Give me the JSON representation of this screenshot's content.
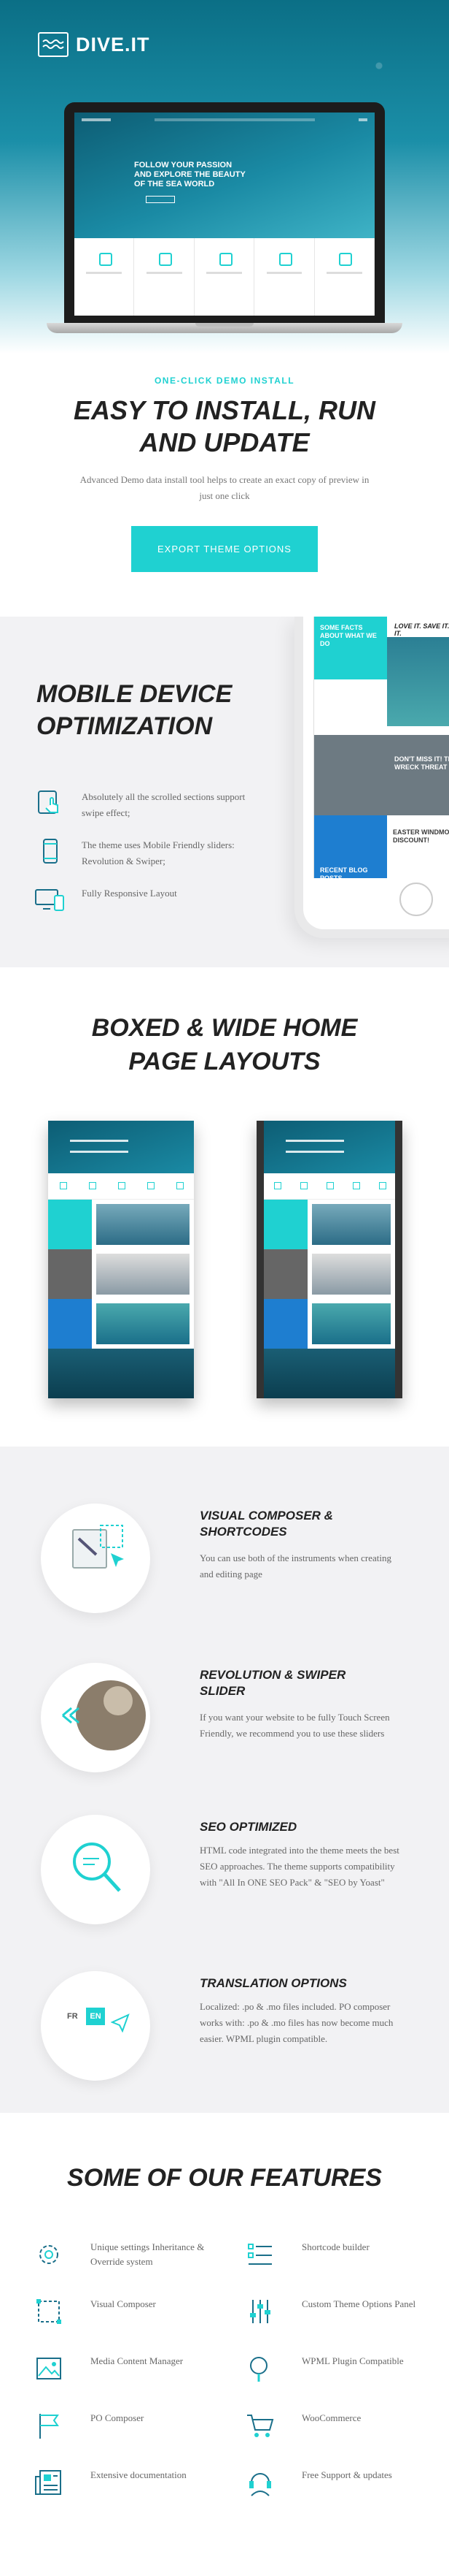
{
  "hero": {
    "logo": "DIVE.IT",
    "laptop_headline_line1": "FOLLOW YOUR PASSION",
    "laptop_headline_line2": "AND EXPLORE THE BEAUTY",
    "laptop_headline_line3": "OF THE SEA WORLD"
  },
  "install": {
    "eyebrow": "ONE-CLICK DEMO INSTALL",
    "title_line1": "EASY TO INSTALL, RUN",
    "title_line2": "AND UPDATE",
    "description": "Advanced Demo data install tool helps to create an exact copy of preview in just one click",
    "button": "EXPORT THEME OPTIONS"
  },
  "mobile": {
    "title_line1": "MOBILE DEVICE",
    "title_line2": "OPTIMIZATION",
    "features": [
      {
        "text": "Absolutely all the scrolled sections support swipe effect;",
        "icon": "touch-tablet-icon"
      },
      {
        "text": "The theme uses Mobile Friendly sliders: Revolution & Swiper;",
        "icon": "smartphone-icon"
      },
      {
        "text": "Fully Responsive Layout",
        "icon": "devices-icon"
      }
    ],
    "phone": {
      "header": "LOVE IT. SAVE IT. DIVE IT.",
      "blocks": [
        "SOME FACTS ABOUT WHAT WE DO",
        "DON'T MISS IT! TRIPLE WRECK THREAT",
        "EASTER WINDMOUNT DISCOUNT!",
        "RECENT BLOG POSTS"
      ]
    }
  },
  "boxed": {
    "title_line1": "BOXED & WIDE HOME",
    "title_line2": "PAGE LAYOUTS"
  },
  "feature_rows": [
    {
      "title_line1": "VISUAL COMPOSER &",
      "title_line2": "SHORTCODES",
      "description": "You can use both of the instruments when creating and editing page",
      "icon": "cursor-click-icon"
    },
    {
      "title_line1": "REVOLUTION & SWIPER",
      "title_line2": "SLIDER",
      "description": "If you want your website to be fully Touch Screen Friendly, we recommend you to use these sliders",
      "icon": "slider-arrows-icon"
    },
    {
      "title_line1": "SEO OPTIMIZED",
      "title_line2": "",
      "description": "HTML code integrated into the theme meets the best  SEO approaches. The theme supports compatibility with \"All In ONE SEO Pack\" & \"SEO by Yoast\"",
      "icon": "magnifier-icon"
    },
    {
      "title_line1": "TRANSLATION OPTIONS",
      "title_line2": "",
      "description": "Localized: .po & .mo files included. PO composer works with: .po & .mo files has now become much easier. WPML plugin compatible.",
      "icon": "language-switch-icon",
      "lang_a": "FR",
      "lang_b": "EN"
    }
  ],
  "some_features": {
    "title": "SOME OF OUR FEATURES",
    "items": [
      {
        "text": "Unique settings Inheritance & Override system",
        "icon": "gear-icon"
      },
      {
        "text": "Shortcode builder",
        "icon": "list-icon"
      },
      {
        "text": "Visual Composer",
        "icon": "selection-icon"
      },
      {
        "text": "Custom Theme Options Panel",
        "icon": "sliders-icon"
      },
      {
        "text": "Media Content Manager",
        "icon": "image-icon"
      },
      {
        "text": "WPML Plugin Compatible",
        "icon": "search-doc-icon"
      },
      {
        "text": "PO Composer",
        "icon": "flag-icon"
      },
      {
        "text": "WooCommerce",
        "icon": "cart-icon"
      },
      {
        "text": "Extensive documentation",
        "icon": "newspaper-icon"
      },
      {
        "text": "Free Support & updates",
        "icon": "support-headset-icon"
      }
    ]
  },
  "colors": {
    "accent": "#1fd1d1",
    "ocean": "#1a8aa4",
    "dark": "#222222"
  }
}
